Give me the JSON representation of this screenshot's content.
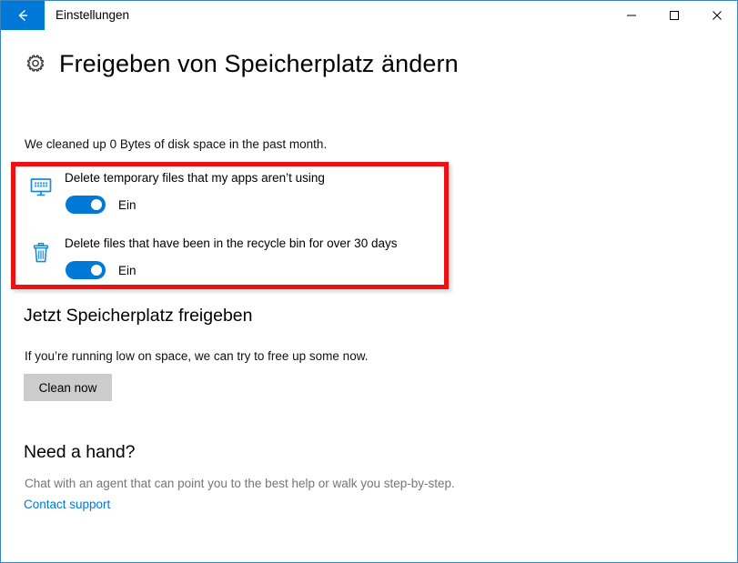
{
  "window": {
    "title": "Einstellungen",
    "back_icon": "back-arrow-icon",
    "minimize_label": "—",
    "maximize_label": "□",
    "close_label": "✕",
    "accent_color": "#0078d7",
    "border_color": "#3a87bd"
  },
  "page": {
    "icon": "gear-icon",
    "title": "Freigeben von Speicherplatz ändern",
    "subtitle": "We cleaned up 0 Bytes of disk space in the past month."
  },
  "highlight": {
    "color": "#ee1111",
    "border_width_px": 5
  },
  "settings": [
    {
      "icon": "monitor-apps-icon",
      "label": "Delete temporary files that my apps aren’t using",
      "toggle_state": "Ein",
      "toggle_on": true
    },
    {
      "icon": "recycle-bin-icon",
      "label": "Delete files that have been in the recycle bin for over 30 days",
      "toggle_state": "Ein",
      "toggle_on": true
    }
  ],
  "free_space_section": {
    "heading": "Jetzt Speicherplatz freigeben",
    "description": "If you’re running low on space, we can try to free up some now.",
    "button_label": "Clean now",
    "button_color": "#cccccc"
  },
  "help_section": {
    "heading": "Need a hand?",
    "description": "Chat with an agent that can point you to the best help or walk you step-by-step.",
    "link_label": "Contact support",
    "link_color": "#0078d7"
  }
}
